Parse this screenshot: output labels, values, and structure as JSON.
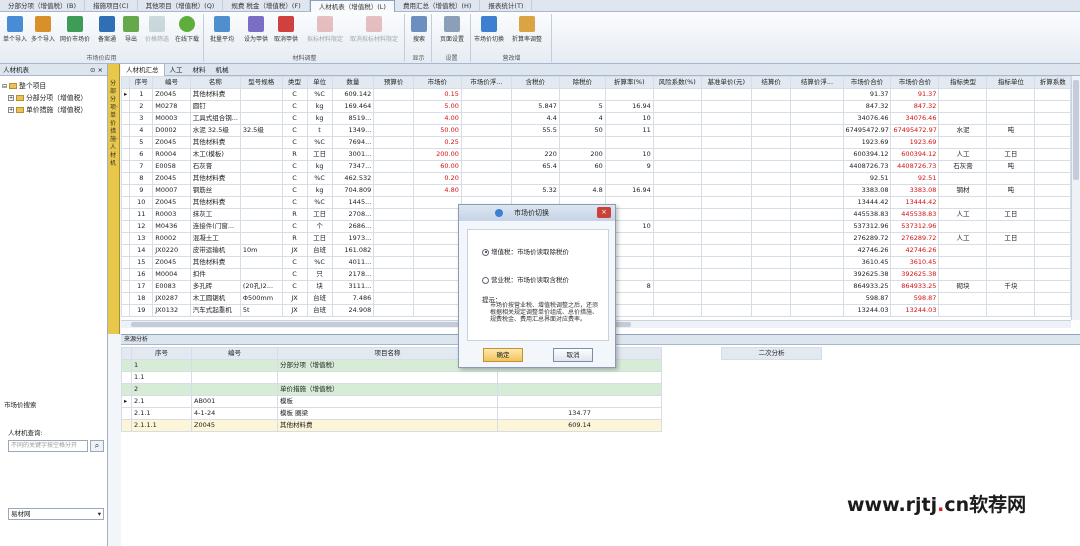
{
  "tabs": [
    "分部分项（增值税）(B)",
    "措施项目(C)",
    "其他项目（增值税）(Q)",
    "规费 税金（增值税）(F)",
    "人材机表（增值税）(L)",
    "费用汇总（增值税）(H)",
    "报表统计(T)"
  ],
  "active_tab": 4,
  "ribbon": {
    "group1": {
      "name": "市场价应用",
      "buttons": [
        "单个导入",
        "多个导入",
        "网价市场价",
        "备案通",
        "导出",
        "价格筛选",
        "在线下载"
      ]
    },
    "group2": {
      "name": "材料调整",
      "buttons": [
        "批量平均",
        "设为甲供",
        "取消甲供",
        "拟标材料限定",
        "取消拟标材料限定"
      ]
    },
    "group3": {
      "name": "显示",
      "buttons": [
        "搜索"
      ]
    },
    "group4": {
      "name": "设置",
      "buttons": [
        "页面设置"
      ]
    },
    "group5": {
      "name": "营改增",
      "buttons": [
        "市场价切换",
        "折算率调整"
      ]
    }
  },
  "left": {
    "header": "人材机表",
    "pin": "⊙ ×",
    "tree": [
      "整个项目",
      "分部分项（增值税）",
      "单价措施（增值税）"
    ],
    "search_title": "市场价搜索",
    "search_label": "人材机查询:",
    "search_placeholder": "不同的关键字按空格分开",
    "select_value": "易材网"
  },
  "vertical_strip": "分部分项·单价措施·人材机",
  "subtabs": [
    "人材机汇总",
    "人工",
    "材料",
    "机械"
  ],
  "table": {
    "headers": [
      "序号",
      "编号",
      "名称",
      "型号规格",
      "类型",
      "单位",
      "数量",
      "预算价",
      "市场价",
      "市场价浮...",
      "含税价",
      "除税价",
      "折算率(%)",
      "风险系数(%)",
      "基准单价(元)",
      "结算价",
      "结算价浮...",
      "市场价合价",
      "市场价合价",
      "指标类型",
      "指标单位",
      "折算系数"
    ],
    "rows": [
      [
        "1",
        "Z0045",
        "其他材料费",
        "",
        "C",
        "%C",
        "609.142",
        "",
        "0.15",
        "",
        "",
        "",
        "",
        "",
        "",
        "",
        "",
        "91.37",
        "91.37",
        "",
        "",
        ""
      ],
      [
        "2",
        "M0278",
        "圆钉",
        "",
        "C",
        "kg",
        "169.464",
        "",
        "5.00",
        "",
        "5.847",
        "5",
        "16.94",
        "",
        "",
        "",
        "",
        "847.32",
        "847.32",
        "",
        "",
        ""
      ],
      [
        "3",
        "M0003",
        "工具式组合钢...",
        "",
        "C",
        "kg",
        "8519...",
        "",
        "4.00",
        "",
        "4.4",
        "4",
        "10",
        "",
        "",
        "",
        "",
        "34076.46",
        "34076.46",
        "",
        "",
        ""
      ],
      [
        "4",
        "D0002",
        "水泥 32.5级",
        "32.5级",
        "C",
        "t",
        "1349...",
        "",
        "50.00",
        "",
        "55.5",
        "50",
        "11",
        "",
        "",
        "",
        "",
        "67495472.97",
        "67495472.97",
        "水泥",
        "吨",
        ""
      ],
      [
        "5",
        "Z0045",
        "其他材料费",
        "",
        "C",
        "%C",
        "7694...",
        "",
        "0.25",
        "",
        "",
        "",
        "",
        "",
        "",
        "",
        "",
        "1923.69",
        "1923.69",
        "",
        "",
        ""
      ],
      [
        "6",
        "R0004",
        "木工(模板)",
        "",
        "R",
        "工日",
        "3001...",
        "",
        "200.00",
        "",
        "220",
        "200",
        "10",
        "",
        "",
        "",
        "",
        "600394.12",
        "600394.12",
        "人工",
        "工日",
        ""
      ],
      [
        "7",
        "E0058",
        "石灰膏",
        "",
        "C",
        "kg",
        "7347...",
        "",
        "60.00",
        "",
        "65.4",
        "60",
        "9",
        "",
        "",
        "",
        "",
        "4408726.73",
        "4408726.73",
        "石灰膏",
        "吨",
        ""
      ],
      [
        "8",
        "Z0045",
        "其他材料费",
        "",
        "C",
        "%C",
        "462.532",
        "",
        "0.20",
        "",
        "",
        "",
        "",
        "",
        "",
        "",
        "",
        "92.51",
        "92.51",
        "",
        "",
        ""
      ],
      [
        "9",
        "M0007",
        "钢筋丝",
        "",
        "C",
        "kg",
        "704.809",
        "",
        "4.80",
        "",
        "5.32",
        "4.8",
        "16.94",
        "",
        "",
        "",
        "",
        "3383.08",
        "3383.08",
        "钢材",
        "吨",
        ""
      ],
      [
        "10",
        "Z0045",
        "其他材料费",
        "",
        "C",
        "%C",
        "1445...",
        "",
        "",
        "",
        "",
        "",
        "",
        "",
        "",
        "",
        "",
        "13444.42",
        "13444.42",
        "",
        "",
        ""
      ],
      [
        "11",
        "R0003",
        "抹灰工",
        "",
        "R",
        "工日",
        "2708...",
        "",
        "",
        "",
        "",
        "",
        "",
        "",
        "",
        "",
        "",
        "445538.83",
        "445538.83",
        "人工",
        "工日",
        ""
      ],
      [
        "12",
        "M0436",
        "连接件(门窗...",
        "",
        "C",
        "个",
        "2686...",
        "",
        "",
        "",
        "",
        "",
        "10",
        "",
        "",
        "",
        "",
        "537312.96",
        "537312.96",
        "",
        "",
        ""
      ],
      [
        "13",
        "R0002",
        "混凝土工",
        "",
        "R",
        "工日",
        "1973...",
        "",
        "",
        "",
        "",
        "",
        "",
        "",
        "",
        "",
        "",
        "276289.72",
        "276289.72",
        "人工",
        "工日",
        ""
      ],
      [
        "14",
        "JX0220",
        "皮带运输机",
        "10m",
        "JX",
        "台班",
        "161.082",
        "",
        "",
        "",
        "",
        "",
        "",
        "",
        "",
        "",
        "",
        "42746.26",
        "42746.26",
        "",
        "",
        ""
      ],
      [
        "15",
        "Z0045",
        "其他材料费",
        "",
        "C",
        "%C",
        "4011...",
        "",
        "",
        "",
        "",
        "",
        "",
        "",
        "",
        "",
        "",
        "3610.45",
        "3610.45",
        "",
        "",
        ""
      ],
      [
        "16",
        "M0004",
        "扣件",
        "",
        "C",
        "只",
        "2178...",
        "",
        "",
        "",
        "",
        "",
        "",
        "",
        "",
        "",
        "",
        "392625.38",
        "392625.38",
        "",
        "",
        ""
      ],
      [
        "17",
        "E0083",
        "多孔砖",
        "(20孔)2...",
        "C",
        "块",
        "3111...",
        "",
        "",
        "",
        "",
        "",
        "8",
        "",
        "",
        "",
        "",
        "864933.25",
        "864933.25",
        "砌块",
        "千块",
        ""
      ],
      [
        "18",
        "JX0287",
        "木工圆锯机",
        "Φ500mm",
        "JX",
        "台班",
        "7.486",
        "",
        "",
        "",
        "",
        "",
        "",
        "",
        "",
        "",
        "",
        "598.87",
        "598.87",
        "",
        "",
        ""
      ],
      [
        "19",
        "JX0132",
        "汽车式起重机",
        "5t",
        "JX",
        "台班",
        "24.908",
        "",
        "",
        "",
        "",
        "",
        "",
        "",
        "",
        "",
        "",
        "13244.03",
        "13244.03",
        "",
        "",
        ""
      ]
    ]
  },
  "bottom": {
    "header": "来源分析",
    "headers": [
      "序号",
      "编号",
      "项目名称",
      "",
      "二次分析"
    ],
    "rows": [
      [
        "1",
        "",
        "分部分项（增值税）",
        ""
      ],
      [
        "1.1",
        "",
        "",
        ""
      ],
      [
        "2",
        "",
        "单价措施（增值税）",
        ""
      ],
      [
        "2.1",
        "AB001",
        "模板",
        ""
      ],
      [
        "2.1.1",
        "4-1-24",
        "模板 圈梁",
        "134.77"
      ],
      [
        "2.1.1.1",
        "Z0045",
        "其他材料费",
        "609.14"
      ]
    ]
  },
  "dialog": {
    "title": "市场价切换",
    "close": "×",
    "option1": "增值税：市场价读取除税价",
    "option2": "营业税：市场价读取含税价",
    "hint_title": "提示：",
    "hint": "市场价按营业税、增值税调整之后，还须根据相关规定调整单价组成、总价措施、规费税金、费用汇总界面对应费率。",
    "ok": "确定",
    "cancel": "取消"
  },
  "watermark": {
    "a": "www.rjtj",
    "dot": ".",
    "b": "cn软荐网"
  }
}
